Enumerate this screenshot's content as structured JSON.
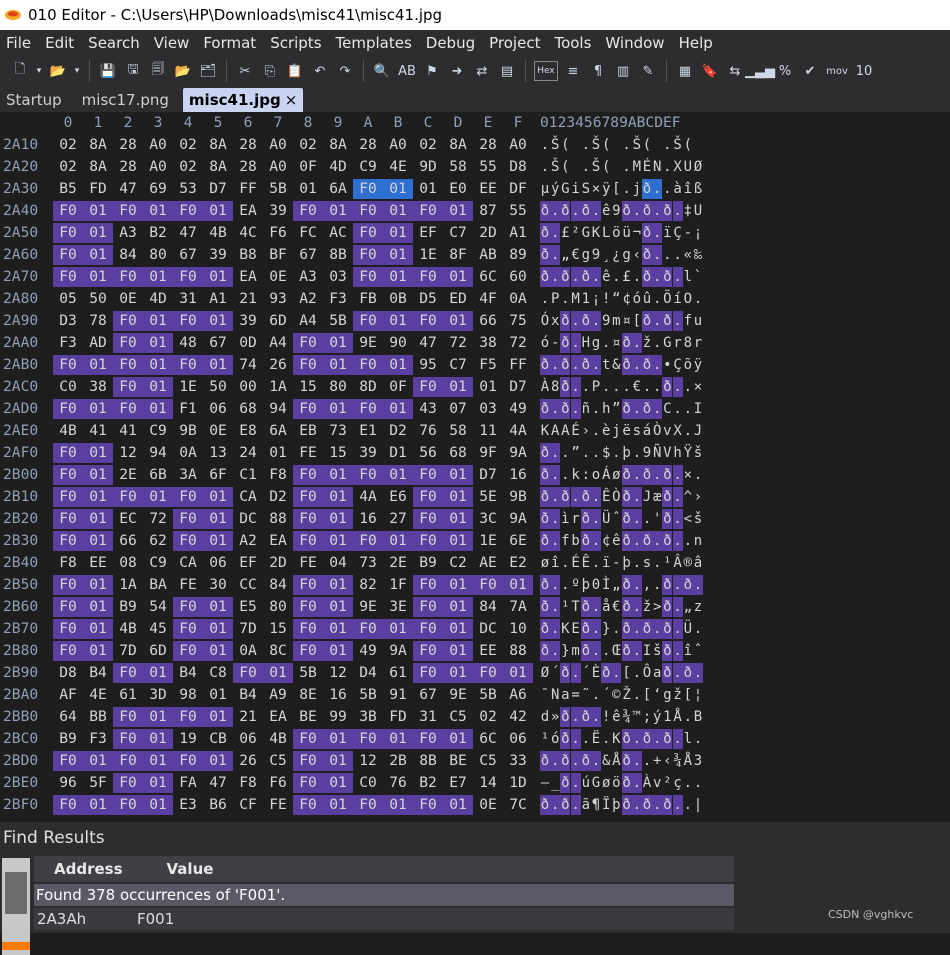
{
  "window": {
    "title": "010 Editor - C:\\Users\\HP\\Downloads\\misc41\\misc41.jpg"
  },
  "menu": [
    "File",
    "Edit",
    "Search",
    "View",
    "Format",
    "Scripts",
    "Templates",
    "Debug",
    "Project",
    "Tools",
    "Window",
    "Help"
  ],
  "toolbar": {
    "icons": [
      "new-file-icon",
      "dropdown-icon",
      "open-folder-icon",
      "dropdown-icon",
      "save-icon",
      "save-as-icon",
      "save-all-icon",
      "open-folder-icon",
      "open-multiple-icon",
      "cut-icon",
      "copy-icon",
      "paste-icon",
      "undo-icon",
      "redo-icon",
      "find-icon",
      "replace-icon",
      "find-in-files-icon",
      "goto-icon",
      "compare-icon",
      "template-icon",
      "hex-icon",
      "text-icon",
      "paragraph-icon",
      "columns-icon",
      "highlight-icon",
      "calculator-icon",
      "bookmark-icon",
      "swap-icon",
      "histogram-icon",
      "percent-icon",
      "checksum-icon",
      "mov-icon",
      "base-convert-icon"
    ],
    "labels": {
      "hex": "Hex",
      "mov": "mov"
    }
  },
  "tabs": [
    {
      "label": "Startup",
      "active": false
    },
    {
      "label": "misc17.png",
      "active": false
    },
    {
      "label": "misc41.jpg",
      "active": true,
      "close": "×"
    }
  ],
  "hex": {
    "header_cols": [
      "0",
      "1",
      "2",
      "3",
      "4",
      "5",
      "6",
      "7",
      "8",
      "9",
      "A",
      "B",
      "C",
      "D",
      "E",
      "F"
    ],
    "header_text": "0123456789ABCDEF",
    "rows": [
      {
        "addr": "2A10",
        "bytes": "02 8A 28 A0 02 8A 28 A0 02 8A 28 A0 02 8A 28 A0",
        "text": ".Š( .Š( .Š( .Š("
      },
      {
        "addr": "2A20",
        "bytes": "02 8A 28 A0 02 8A 28 A0 0F 4D C9 4E 9D 58 55 D8",
        "text": ".Š( .Š( .MÉN.XUØ"
      },
      {
        "addr": "2A30",
        "bytes": "B5 FD 47 69 53 D7 FF 5B 01 6A F0 01 01 E0 EE DF",
        "text": "µýGiS×ÿ[.jð..àîß"
      },
      {
        "addr": "2A40",
        "bytes": "F0 01 F0 01 F0 01 EA 39 F0 01 F0 01 F0 01 87 55",
        "text": "ð.ð.ð.ê9ð.ð.ð.‡U"
      },
      {
        "addr": "2A50",
        "bytes": "F0 01 A3 B2 47 4B 4C F6 FC AC F0 01 EF C7 2D A1",
        "text": "ð.£²GKLöü¬ð.ïÇ-¡"
      },
      {
        "addr": "2A60",
        "bytes": "F0 01 84 80 67 39 B8 BF 67 8B F0 01 1E 8F AB 89",
        "text": "ð.„€g9¸¿g‹ð...«‰"
      },
      {
        "addr": "2A70",
        "bytes": "F0 01 F0 01 F0 01 EA 0E A3 03 F0 01 F0 01 6C 60",
        "text": "ð.ð.ð.ê.£.ð.ð.l`"
      },
      {
        "addr": "2A80",
        "bytes": "05 50 0E 4D 31 A1 21 93 A2 F3 FB 0B D5 ED 4F 0A",
        "text": ".P.M1¡!“¢óû.ÕíO."
      },
      {
        "addr": "2A90",
        "bytes": "D3 78 F0 01 F0 01 39 6D A4 5B F0 01 F0 01 66 75",
        "text": "Óxð.ð.9m¤[ð.ð.fu"
      },
      {
        "addr": "2AA0",
        "bytes": "F3 AD F0 01 48 67 0D A4 F0 01 9E 90 47 72 38 72",
        "text": "ó-ð.Hg.¤ð.ž.Gr8r"
      },
      {
        "addr": "2AB0",
        "bytes": "F0 01 F0 01 F0 01 74 26 F0 01 F0 01 95 C7 F5 FF",
        "text": "ð.ð.ð.t&ð.ð.•Çõÿ"
      },
      {
        "addr": "2AC0",
        "bytes": "C0 38 F0 01 1E 50 00 1A 15 80 8D 0F F0 01 01 D7",
        "text": "À8ð..P...€..ð..×"
      },
      {
        "addr": "2AD0",
        "bytes": "F0 01 F0 01 F1 06 68 94 F0 01 F0 01 43 07 03 49",
        "text": "ð.ð.ñ.h”ð.ð.C..I"
      },
      {
        "addr": "2AE0",
        "bytes": "4B 41 41 C9 9B 0E E8 6A EB 73 E1 D2 76 58 11 4A",
        "text": "KAAÉ›.èjësáÒvX.J"
      },
      {
        "addr": "2AF0",
        "bytes": "F0 01 12 94 0A 13 24 01 FE 15 39 D1 56 68 9F 9A",
        "text": "ð..”..$.þ.9ÑVhŸš"
      },
      {
        "addr": "2B00",
        "bytes": "F0 01 2E 6B 3A 6F C1 F8 F0 01 F0 01 F0 01 D7 16",
        "text": "ð..k:oÁøð.ð.ð.×."
      },
      {
        "addr": "2B10",
        "bytes": "F0 01 F0 01 F0 01 CA D2 F0 01 4A E6 F0 01 5E 9B",
        "text": "ð.ð.ð.ÊÒð.Jæð.^›"
      },
      {
        "addr": "2B20",
        "bytes": "F0 01 EC 72 F0 01 DC 88 F0 01 16 27 F0 01 3C 9A",
        "text": "ð.ìrð.Üˆð..'ð.<š"
      },
      {
        "addr": "2B30",
        "bytes": "F0 01 66 62 F0 01 A2 EA F0 01 F0 01 F0 01 1E 6E",
        "text": "ð.fbð.¢êð.ð.ð..n"
      },
      {
        "addr": "2B40",
        "bytes": "F8 EE 08 C9 CA 06 EF 2D FE 04 73 2E B9 C2 AE E2",
        "text": "øî.ÉÊ.ï-þ.s.¹Â®â"
      },
      {
        "addr": "2B50",
        "bytes": "F0 01 1A BA FE 30 CC 84 F0 01 82 1F F0 01 F0 01",
        "text": "ð..ºþ0Ì„ð.‚.ð.ð."
      },
      {
        "addr": "2B60",
        "bytes": "F0 01 B9 54 F0 01 E5 80 F0 01 9E 3E F0 01 84 7A",
        "text": "ð.¹Tð.å€ð.ž>ð.„z"
      },
      {
        "addr": "2B70",
        "bytes": "F0 01 4B 45 F0 01 7D 15 F0 01 F0 01 F0 01 DC 10",
        "text": "ð.KEð.}.ð.ð.ð.Ü."
      },
      {
        "addr": "2B80",
        "bytes": "F0 01 7D 6D F0 01 0A 8C F0 01 49 9A F0 01 EE 88",
        "text": "ð.}mð..Œð.Išð.îˆ"
      },
      {
        "addr": "2B90",
        "bytes": "D8 B4 F0 01 B4 C8 F0 01 5B 12 D4 61 F0 01 F0 01",
        "text": "Ø´ð.´Èð.[.Ôað.ð."
      },
      {
        "addr": "2BA0",
        "bytes": "AF 4E 61 3D 98 01 B4 A9 8E 16 5B 91 67 9E 5B A6",
        "text": "¯Na=˜.´©Ž.[‘gž[¦"
      },
      {
        "addr": "2BB0",
        "bytes": "64 BB F0 01 F0 01 21 EA BE 99 3B FD 31 C5 02 42",
        "text": "d»ð.ð.!ê¾™;ý1Å.B"
      },
      {
        "addr": "2BC0",
        "bytes": "B9 F3 F0 01 19 CB 06 4B F0 01 F0 01 F0 01 6C 06",
        "text": "¹óð..Ë.Kð.ð.ð.l."
      },
      {
        "addr": "2BD0",
        "bytes": "F0 01 F0 01 F0 01 26 C5 F0 01 12 2B 8B BE C5 33",
        "text": "ð.ð.ð.&Åð..+‹¾Å3"
      },
      {
        "addr": "2BE0",
        "bytes": "96 5F F0 01 FA 47 F8 F6 F0 01 C0 76 B2 E7 14 1D",
        "text": "–_ð.úGøöð.Àv²ç.."
      },
      {
        "addr": "2BF0",
        "bytes": "F0 01 F0 01 E3 B6 CF FE F0 01 F0 01 F0 01 0E 7C",
        "text": "ð.ð.ã¶Ïþð.ð.ð..|"
      }
    ]
  },
  "find": {
    "title": "Find Results",
    "col_address": "Address",
    "col_value": "Value",
    "message": "Found 378 occurrences of 'F001'.",
    "results": [
      {
        "address": "2A3Ah",
        "value": "F001"
      }
    ]
  },
  "watermark": "CSDN @vghkvc",
  "colors": {
    "highlight": "#5b3fa0",
    "cursor": "#2f6fd0",
    "background": "#1e1e1e",
    "chrome": "#2d2d30"
  }
}
